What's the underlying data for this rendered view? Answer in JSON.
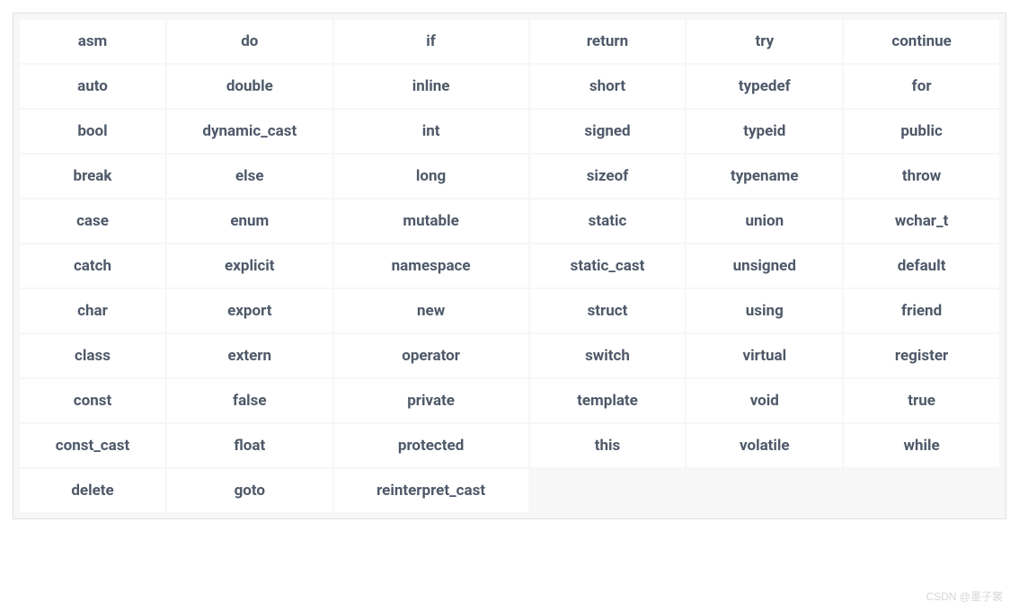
{
  "table": {
    "rows": [
      [
        "asm",
        "do",
        "if",
        "return",
        "try",
        "continue"
      ],
      [
        "auto",
        "double",
        "inline",
        "short",
        "typedef",
        "for"
      ],
      [
        "bool",
        "dynamic_cast",
        "int",
        "signed",
        "typeid",
        "public"
      ],
      [
        "break",
        "else",
        "long",
        "sizeof",
        "typename",
        "throw"
      ],
      [
        "case",
        "enum",
        "mutable",
        "static",
        "union",
        "wchar_t"
      ],
      [
        "catch",
        "explicit",
        "namespace",
        "static_cast",
        "unsigned",
        "default"
      ],
      [
        "char",
        "export",
        "new",
        "struct",
        "using",
        "friend"
      ],
      [
        "class",
        "extern",
        "operator",
        "switch",
        "virtual",
        "register"
      ],
      [
        "const",
        "false",
        "private",
        "template",
        "void",
        "true"
      ],
      [
        "const_cast",
        "float",
        "protected",
        "this",
        "volatile",
        "while"
      ],
      [
        "delete",
        "goto",
        "reinterpret_cast",
        "",
        "",
        ""
      ]
    ]
  },
  "watermark": "CSDN @墨子裳"
}
